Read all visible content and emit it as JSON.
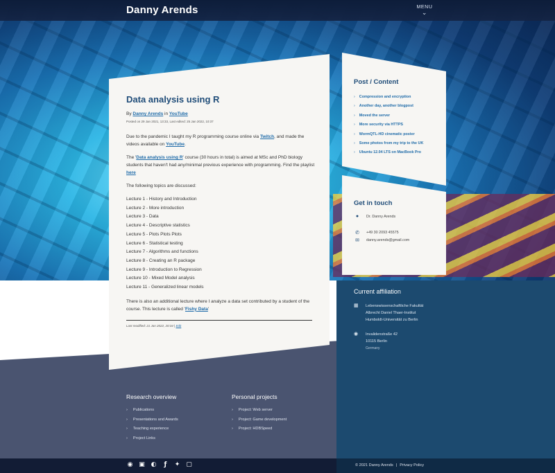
{
  "header": {
    "brand": "Danny Arends",
    "menu_label": "MENU"
  },
  "post": {
    "title": "Data analysis using R",
    "byline_prefix": "By",
    "author": "Danny Arends",
    "byline_in": "in",
    "category": "YouTube",
    "posted": "Posted on 29 Jan 2021, 13:33, Last edited: 25 Jan 2022, 10:37",
    "intro_before": "Due to the pandemic I taught my R programming course online via ",
    "intro_link1": "Twitch",
    "intro_mid": ", and made the videos available on ",
    "intro_link2": "YouTube",
    "intro_end": ".",
    "course_before": "The '",
    "course_link": "Data analysis using R",
    "course_mid": "' course (30 hours in total) is aimed at MSc and PhD biology students that haven't had any/minimal previous experience with programming. Find the playlist ",
    "course_link2": "here",
    "topics_intro": "The following topics are discussed:",
    "lectures": [
      "Lecture 1 - History and Introduction",
      "Lecture 2 - More introduction",
      "Lecture 3 - Data",
      "Lecture 4 - Descriptive statistics",
      "Lecture 5 - Plots Plots Plots",
      "Lecture 6 - Statistical testing",
      "Lecture 7 - Algorithms and functions",
      "Lecture 8 - Creating an R package",
      "Lecture 9 - Introduction to Regression",
      "Lecture 10 - Mixed Model analysis",
      "Lecture 11 - Generalized linear models"
    ],
    "extra_before": "There is also an additional lecture where I analyze a data set contributed by a student of the course. This lecture is called '",
    "extra_link": "Fishy Data",
    "extra_end": "'",
    "last_modified": "Last modified: 21 Jan 2022, 20:34 |",
    "edit_link": "Edit"
  },
  "sidebar": {
    "posts_title": "Post / Content",
    "posts": [
      "Compression and encryption",
      "Another day, another blogpost",
      "Moved the server",
      "More security via HTTPS",
      "WormQTL-HD cinematic poster",
      "Some photos from my trip to the UK",
      "Ubuntu 12.04 LTS on MacBook Pro"
    ],
    "contact_title": "Get in touch",
    "contact_name": "Dr. Danny Arends",
    "contact_phone": "+49 30 2093 45575",
    "contact_email": "danny.arends@gmail.com"
  },
  "affiliation": {
    "title": "Current affiliation",
    "institute_lines": [
      "Lebenswissenschaftliche Fakultät",
      "Albrecht Daniel Thaer-Institut",
      "Humboldt-Universität zu Berlin"
    ],
    "address_lines": [
      "Invalidenstraße 42",
      "10115 Berlin",
      "Germany"
    ]
  },
  "footer": {
    "research_title": "Research overview",
    "research_items": [
      "Publications",
      "Presentations and Awards",
      "Teaching experience",
      "Project Links"
    ],
    "personal_title": "Personal projects",
    "personal_items": [
      "Project: Web server",
      "Project: Game development",
      "Project: HDBSpeed"
    ],
    "copyright": "© 2021 Danny Arends",
    "privacy": "Privacy Policy"
  },
  "icons": {
    "social": [
      "github-icon",
      "linkedin-icon",
      "instagram-icon",
      "facebook-icon",
      "twitter-icon",
      "twitch-icon"
    ]
  }
}
